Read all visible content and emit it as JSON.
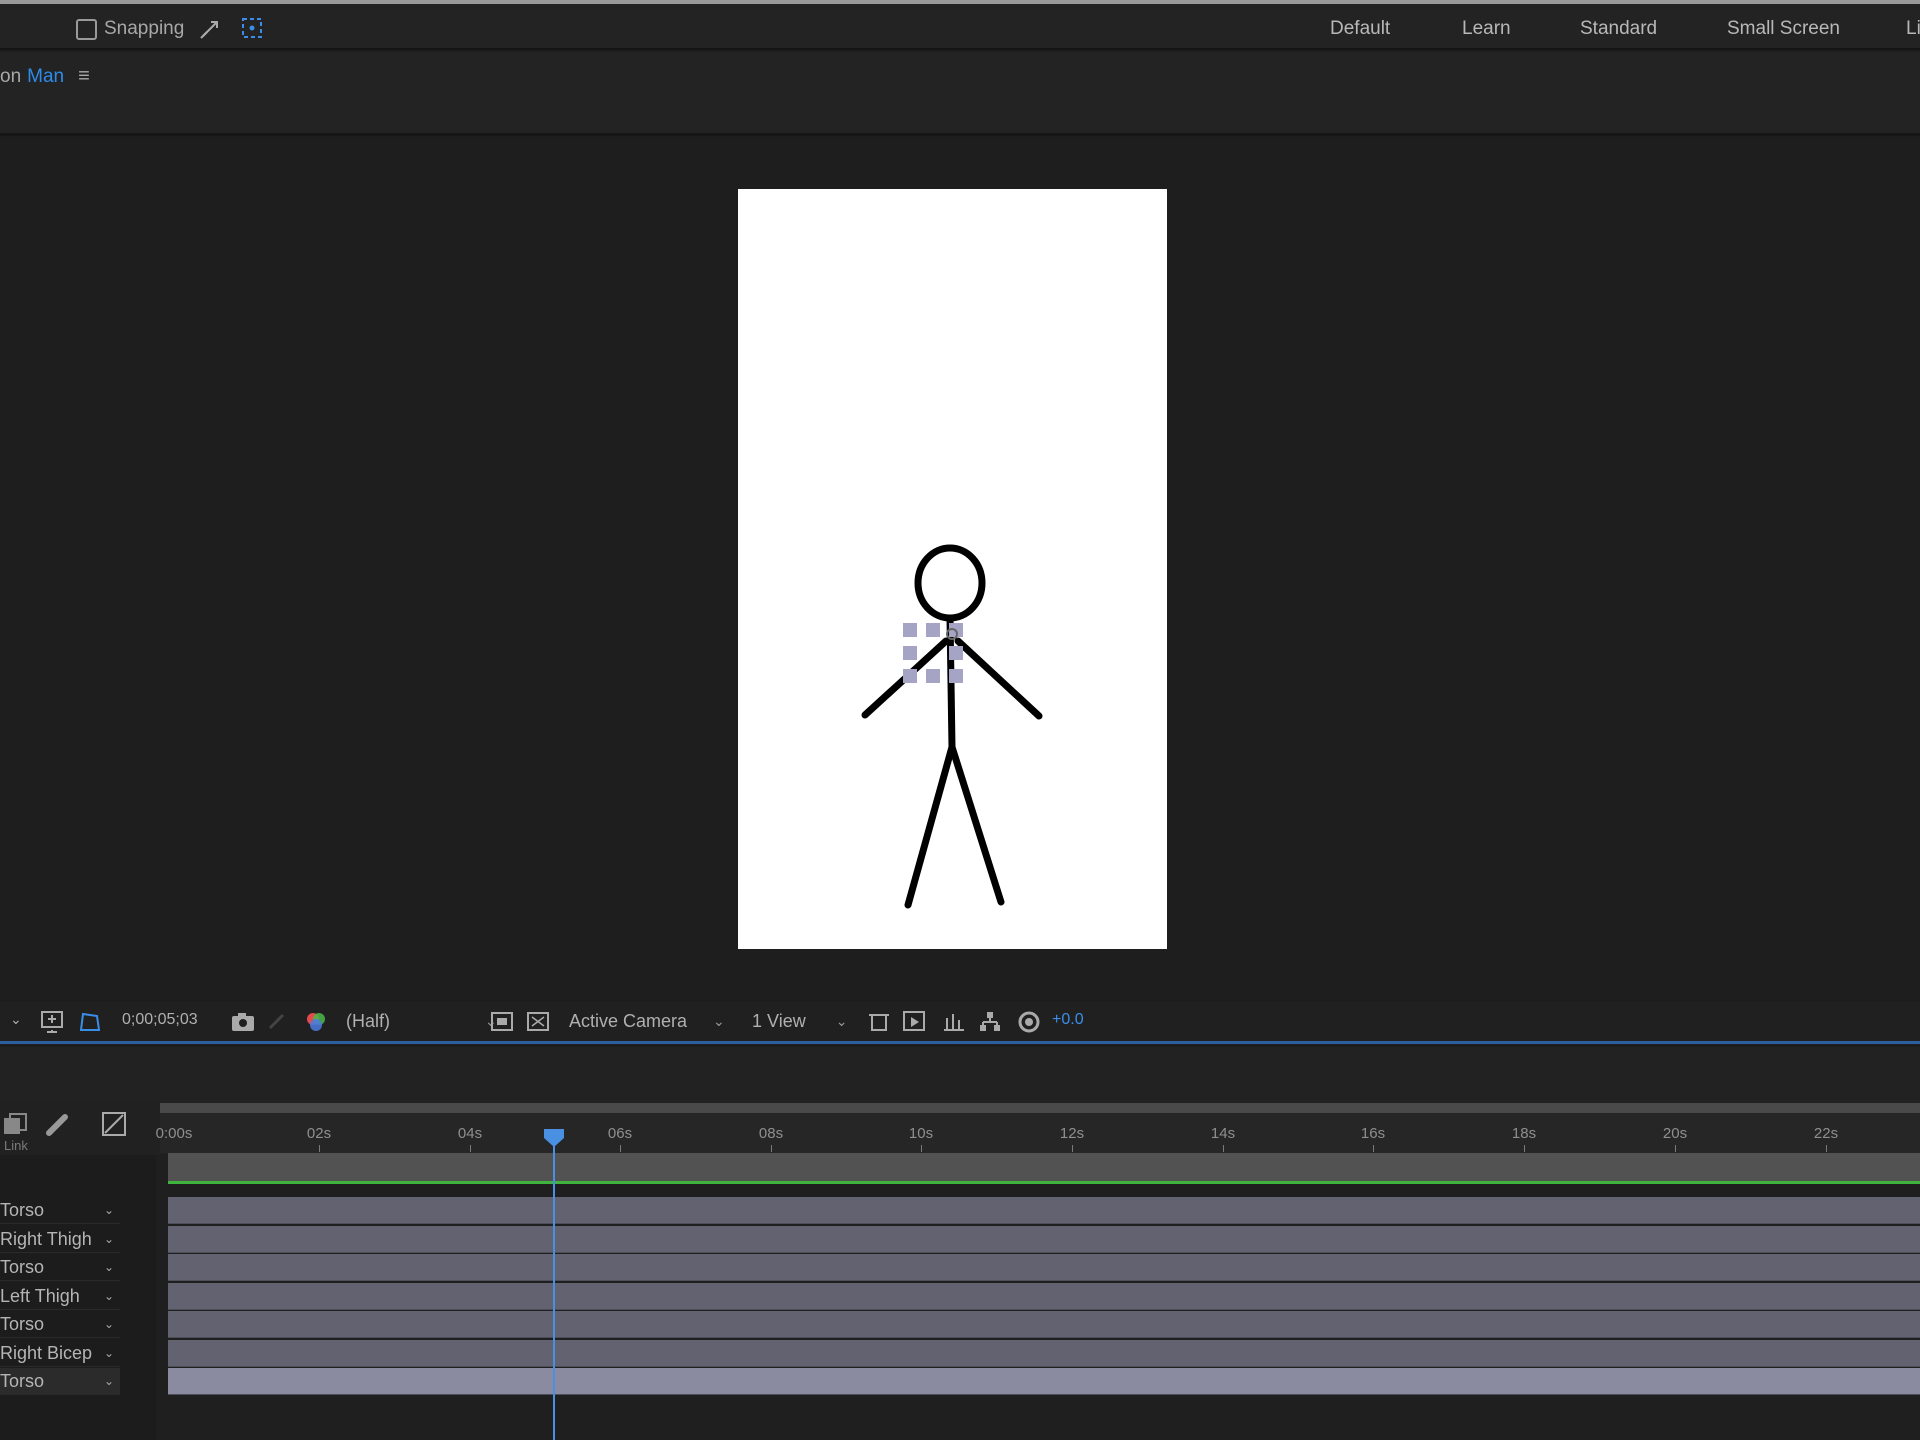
{
  "toolbar": {
    "snapping_label": "Snapping",
    "workspaces": [
      "Default",
      "Learn",
      "Standard",
      "Small Screen",
      "Li"
    ]
  },
  "composition": {
    "tab_prefix": "on",
    "tab_name": "Man",
    "menu_icon": "hamburger-icon"
  },
  "viewer_footer": {
    "timecode": "0;00;05;03",
    "resolution": "(Half)",
    "camera": "Active Camera",
    "views": "1 View",
    "exposure": "+0.0"
  },
  "timeline": {
    "header_link_label": "Link",
    "ruler_labels": [
      "0:00s",
      "02s",
      "04s",
      "06s",
      "08s",
      "10s",
      "12s",
      "14s",
      "16s",
      "18s",
      "20s",
      "22s"
    ],
    "playhead_time": "0;00;05;03",
    "layers": [
      {
        "parent": "Torso",
        "selected": false
      },
      {
        "parent": "Right Thigh",
        "selected": false
      },
      {
        "parent": "Torso",
        "selected": false
      },
      {
        "parent": "Left Thigh",
        "selected": false
      },
      {
        "parent": "Torso",
        "selected": false
      },
      {
        "parent": "Right Bicep",
        "selected": false
      },
      {
        "parent": "Torso",
        "selected": true
      }
    ]
  },
  "colors": {
    "accent_blue": "#2d8ceb",
    "work_area_green": "#3fb53f",
    "layer_bar": "#626270",
    "layer_bar_selected": "#8a8aa0"
  }
}
